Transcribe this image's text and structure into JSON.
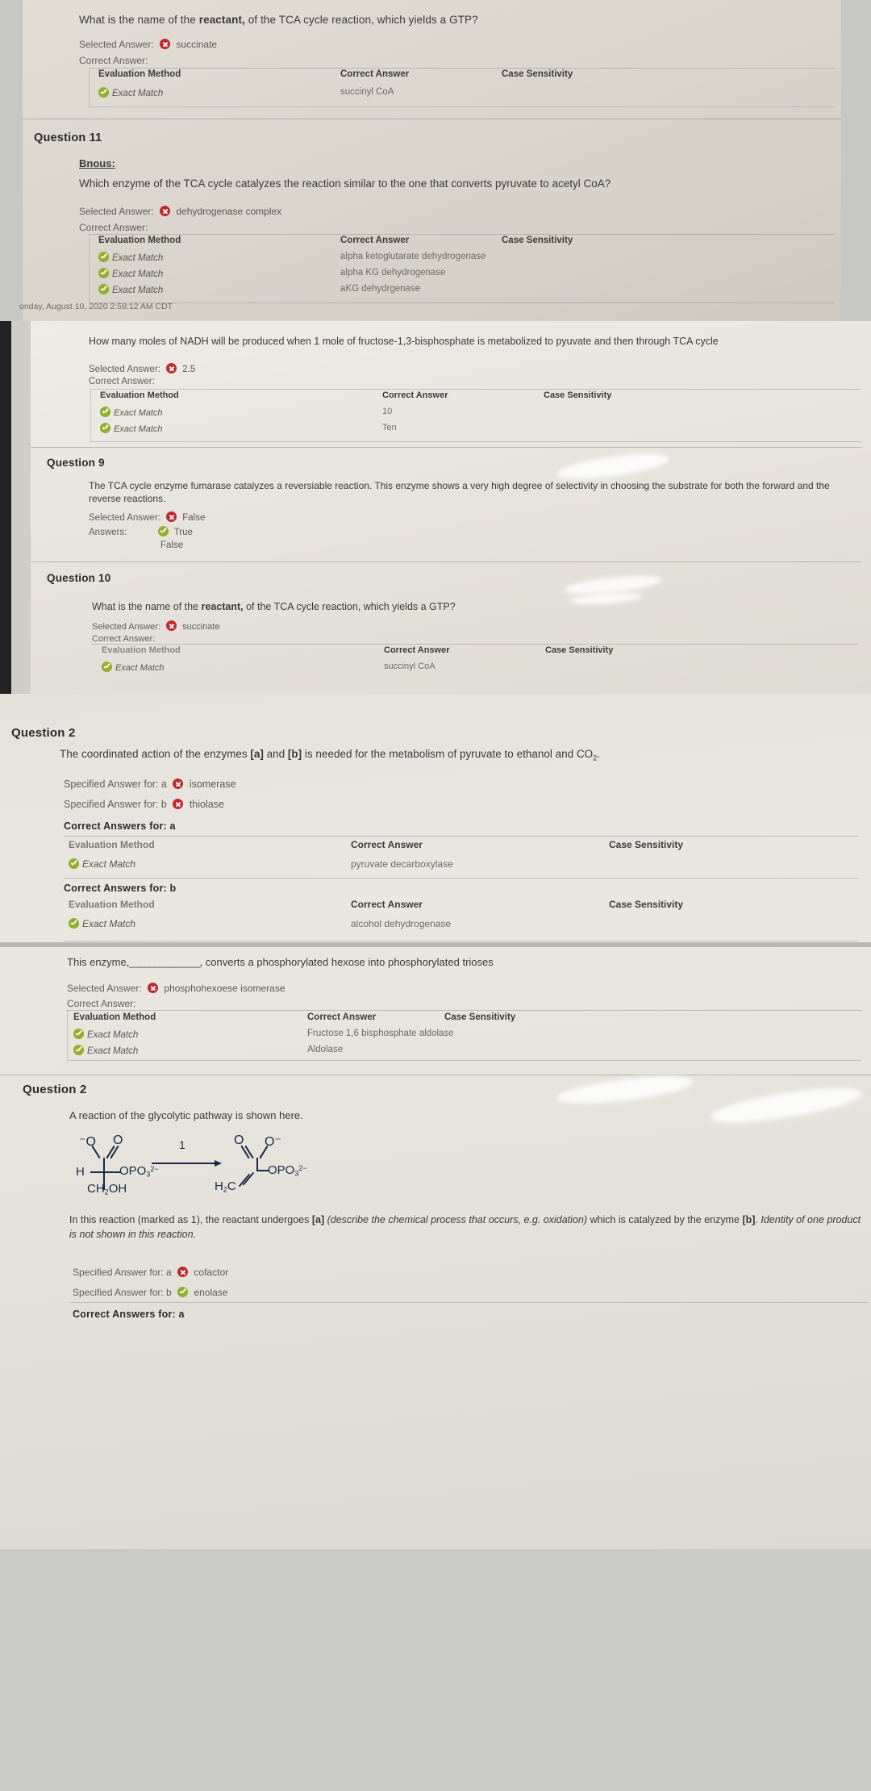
{
  "labels": {
    "selected_answer": "Selected Answer:",
    "correct_answer_label": "Correct Answer:",
    "answers_label": "Answers:",
    "evaluation_method": "Evaluation Method",
    "correct_answer_col": "Correct Answer",
    "case_sensitivity_col": "Case Sensitivity",
    "exact_match": "Exact Match",
    "specified_answer_a": "Specified Answer for: a",
    "specified_answer_b": "Specified Answer for: b",
    "correct_answers_for_a": "Correct Answers for: a",
    "correct_answers_for_b": "Correct Answers for: b"
  },
  "panel1": {
    "question_top": {
      "text_part1": "What is the name of the ",
      "text_bold": "reactant,",
      "text_part2": " of the TCA cycle reaction, which yields a GTP?",
      "selected_answer": "succinate",
      "rows": [
        {
          "method": "Exact Match",
          "answer": "succinyl CoA",
          "case": ""
        }
      ]
    },
    "question_11": {
      "heading": "Question 11",
      "bonus_label": "Bnous:",
      "text": "Which enzyme of the TCA cycle catalyzes the reaction similar to the one that converts pyruvate to acetyl CoA?",
      "selected_answer": "dehydrogenase complex",
      "rows": [
        {
          "method": "Exact Match",
          "answer": "alpha ketoglutarate dehydrogenase",
          "case": ""
        },
        {
          "method": "Exact Match",
          "answer": "alpha KG dehydrogenase",
          "case": ""
        },
        {
          "method": "Exact Match",
          "answer": "aKG dehydrgenase",
          "case": ""
        }
      ]
    },
    "timestamp": "onday, August 10, 2020 2:58:12 AM CDT"
  },
  "panel2": {
    "question_nadh": {
      "text": "How many moles of NADH will be produced when 1 mole of fructose-1,3-bisphosphate is metabolized to pyuvate and then through TCA cycle",
      "selected_answer": "2.5",
      "rows": [
        {
          "method": "Exact Match",
          "answer": "10",
          "case": ""
        },
        {
          "method": "Exact Match",
          "answer": "Ten",
          "case": ""
        }
      ]
    },
    "question_9": {
      "heading": "Question 9",
      "text": "The TCA cycle enzyme fumarase catalyzes a reversiable reaction. This enzyme shows a very high degree of selectivity in choosing the substrate for both the forward and the reverse reactions.",
      "selected_answer": "False",
      "answers": [
        {
          "label": "True",
          "state": "right"
        },
        {
          "label": "False",
          "state": "none"
        }
      ]
    },
    "question_10": {
      "heading": "Question 10",
      "text_part1": "What is the name of the ",
      "text_bold": "reactant,",
      "text_part2": " of the TCA cycle reaction, which yields a GTP?",
      "selected_answer": "succinate",
      "rows": [
        {
          "method": "Exact Match",
          "answer": "succinyl CoA",
          "case": ""
        }
      ]
    }
  },
  "panel3": {
    "question_2": {
      "heading": "Question 2",
      "text_part1": "The coordinated action of the enzymes ",
      "tag_a": "[a]",
      "text_mid": " and ",
      "tag_b": "[b]",
      "text_part2": " is needed for the metabolism of pyruvate to ethanol and CO",
      "text_sub": "2",
      "text_end": ".",
      "specified_a": "isomerase",
      "specified_b": "thiolase",
      "rows_a": [
        {
          "method": "Exact Match",
          "answer": "pyruvate decarboxylase",
          "case": ""
        }
      ],
      "rows_b": [
        {
          "method": "Exact Match",
          "answer": "alcohol dehydrogenase",
          "case": ""
        }
      ]
    },
    "question_enzyme": {
      "text_part1": "This enzyme,",
      "blank": "______________",
      "text_part2": ", converts a phosphorylated hexose into phosphorylated trioses",
      "selected_answer": "phosphohexoese isomerase",
      "rows": [
        {
          "method": "Exact Match",
          "answer": "Fructose 1,6 bisphosphate aldolase",
          "case": ""
        },
        {
          "method": "Exact Match",
          "answer": "Aldolase",
          "case": ""
        }
      ]
    }
  },
  "panel4": {
    "question_2": {
      "heading": "Question 2",
      "intro": "A reaction of the glycolytic pathway is shown here.",
      "reaction": {
        "step_number": "1",
        "left": {
          "top_left_o": "⁻O",
          "top_right_o": "O",
          "h": "H",
          "opo3": "OPO",
          "opo3_sub": "3",
          "opo3_sup": "2−",
          "bottom": "CH",
          "bottom_sub": "2",
          "bottom_end": "OH"
        },
        "right": {
          "top_left_o": "O",
          "top_right_o": "O⁻",
          "h2c": "H",
          "h2c_sub": "2",
          "h2c_end": "C",
          "opo3": "OPO",
          "opo3_sub": "3",
          "opo3_sup": "2−"
        }
      },
      "explain_part1": "In this reaction (marked as 1), the reactant undergoes ",
      "explain_tag_a": "[a]",
      "explain_ital1": " (describe the chemical process that occurs, e.g. oxidation)",
      "explain_part2": " which is catalyzed by the enzyme ",
      "explain_tag_b": "[b]",
      "explain_ital2": ". Identity of one product is not shown in this reaction.",
      "specified_a": "cofactor",
      "specified_b": "enolase",
      "correct_answers_for_a": "Correct Answers for: a"
    }
  },
  "colors": {
    "wrong": "#c1272d",
    "right": "#93ad2c",
    "paper_top": "#ded9d2",
    "paper_mid": "#e6e4de",
    "paper_bottom": "#dedcd4",
    "frame": "#c9c9c7"
  }
}
